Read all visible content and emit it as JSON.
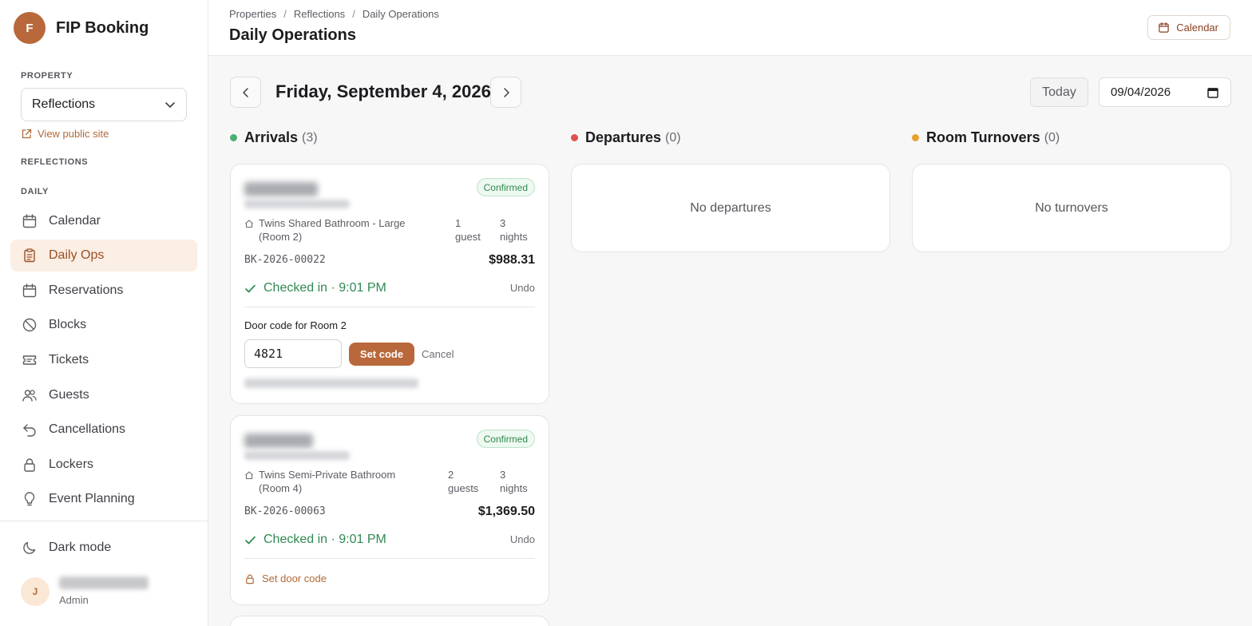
{
  "app": {
    "name": "FIP Booking",
    "logo_letter": "F"
  },
  "sidebar": {
    "property_label": "PROPERTY",
    "property_value": "Reflections",
    "view_public": "View public site",
    "reflections_label": "REFLECTIONS",
    "daily_label": "DAILY",
    "items": [
      {
        "label": "Calendar",
        "icon": "calendar-icon"
      },
      {
        "label": "Daily Ops",
        "icon": "clipboard-icon",
        "active": true
      },
      {
        "label": "Reservations",
        "icon": "calendar-icon"
      },
      {
        "label": "Blocks",
        "icon": "ban-icon"
      },
      {
        "label": "Tickets",
        "icon": "ticket-icon"
      },
      {
        "label": "Guests",
        "icon": "users-icon"
      },
      {
        "label": "Cancellations",
        "icon": "undo-icon"
      },
      {
        "label": "Lockers",
        "icon": "lock-icon"
      },
      {
        "label": "Event Planning",
        "icon": "lightbulb-icon"
      }
    ],
    "dark_mode": "Dark mode",
    "user": {
      "initial": "J",
      "role": "Admin"
    }
  },
  "header": {
    "breadcrumb": [
      "Properties",
      "Reflections",
      "Daily Operations"
    ],
    "title": "Daily Operations",
    "calendar_button": "Calendar"
  },
  "datebar": {
    "date_title": "Friday, September 4, 2026",
    "today_button": "Today",
    "date_input_value": "09/04/2026"
  },
  "columns": {
    "arrivals": {
      "title": "Arrivals",
      "count": "(3)",
      "color": "#4caf72"
    },
    "departures": {
      "title": "Departures",
      "count": "(0)",
      "color": "#e0534d",
      "empty": "No departures"
    },
    "turnovers": {
      "title": "Room Turnovers",
      "count": "(0)",
      "color": "#e8a030",
      "empty": "No turnovers"
    }
  },
  "arrivals": [
    {
      "status": "Confirmed",
      "room_line1": "Twins Shared Bathroom - Large",
      "room_line2": "(Room 2)",
      "guests_num": "1",
      "guests_word": "guest",
      "nights_num": "3",
      "nights_word": "nights",
      "booking_id": "BK-2026-00022",
      "price": "$988.31",
      "checked_in": "Checked in · 9:01 PM",
      "undo": "Undo",
      "door_label": "Door code for Room 2",
      "door_code_value": "4821",
      "set_code": "Set code",
      "cancel": "Cancel"
    },
    {
      "status": "Confirmed",
      "room_line1": "Twins Semi-Private Bathroom",
      "room_line2": "(Room 4)",
      "guests_num": "2",
      "guests_word": "guests",
      "nights_num": "3",
      "nights_word": "nights",
      "booking_id": "BK-2026-00063",
      "price": "$1,369.50",
      "checked_in": "Checked in · 9:01 PM",
      "undo": "Undo",
      "set_door_code": "Set door code"
    }
  ]
}
